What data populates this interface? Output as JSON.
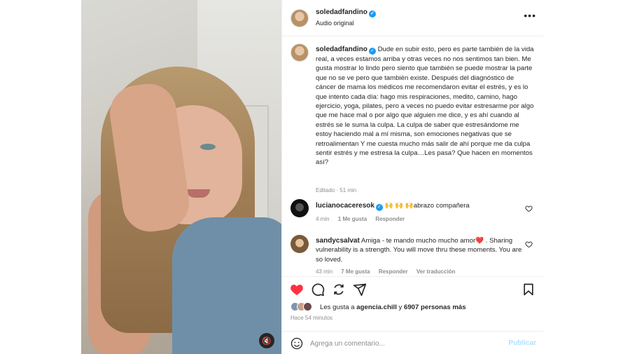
{
  "post": {
    "username": "soledadfandino",
    "audio": "Audio original",
    "more_label": "•••"
  },
  "caption": {
    "username": "soledadfandino",
    "text": "Dude en subir esto, pero es parte también de la vida real, a veces estamos arriba y otras veces no nos sentimos tan bien. Me gusta mostrar lo lindo pero siento que también se puede mostrar la parte que no se ve pero que también existe. Después del diagnóstico de cáncer de mama los médicos me recomendaron evitar el estrés, y es lo que intento cada día: hago mis respiraciones, medito, camino, hago ejercicio, yoga, pilates, pero a veces no puedo evitar estresarme por algo que me hace mal o por algo que alguien me dice, y es ahí cuando al estrés se le suma la culpa. La culpa de saber que estresándome me estoy haciendo mal a mí misma, son emociones negativas que se retroalimentan Y me cuesta mucho más salir de ahí porque me da culpa sentir estrés y me estresa la culpa…Les pasa? Que hacen en momentos así?",
    "meta": "Editado · 51 min"
  },
  "comments": [
    {
      "username": "lucianocaceresok",
      "text": "🙌 🙌 🙌abrazo compañera",
      "time": "4 min",
      "likes": "1 Me gusta",
      "reply": "Responder",
      "translate": ""
    },
    {
      "username": "sandycsalvat",
      "text": "Amiga - te mando mucho mucho amor❤️ . Sharing vulnerability is a strength. You will move thru these moments. You are so loved.",
      "time": "43 min",
      "likes": "7 Me gusta",
      "reply": "Responder",
      "translate": "Ver traducción"
    }
  ],
  "likes": {
    "prefix": "Les gusta a ",
    "account": "agencia.chill",
    "middle": " y ",
    "others": "6907 personas más"
  },
  "time_ago": "Hace 54 minutos",
  "comment_box": {
    "placeholder": "Agrega un comentario...",
    "post_label": "Publicar"
  },
  "colors": {
    "like_red": "#ff3040",
    "verified_blue": "#1d9bf0",
    "publish_blue": "#b2dffc",
    "muted_text": "#8e8e8e"
  }
}
